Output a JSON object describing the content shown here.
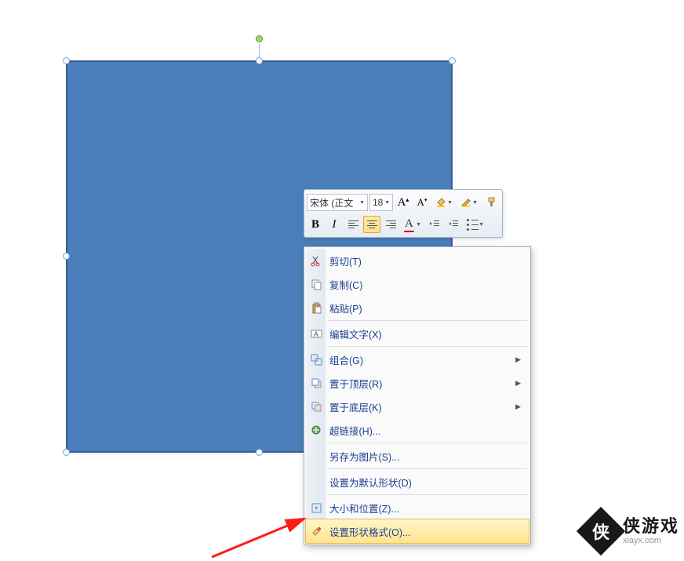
{
  "shape": {
    "fill": "#4a7ebb",
    "border": "#385d8a"
  },
  "toolbar": {
    "font_name": "宋体 (正文",
    "font_size": "18",
    "bold": "B",
    "italic": "I",
    "grow_font": "A",
    "shrink_font": "A",
    "font_color_letter": "A"
  },
  "menu": {
    "cut": "剪切(T)",
    "copy": "复制(C)",
    "paste": "粘贴(P)",
    "edit_text": "编辑文字(X)",
    "group": "组合(G)",
    "bring_front": "置于顶层(R)",
    "send_back": "置于底层(K)",
    "hyperlink": "超链接(H)...",
    "save_as_pic": "另存为图片(S)...",
    "set_default": "设置为默认形状(D)",
    "size_pos": "大小和位置(Z)...",
    "format_shape": "设置形状格式(O)..."
  },
  "watermark": {
    "badge": "侠",
    "cn": "侠游戏",
    "en": "xiayx.com"
  }
}
